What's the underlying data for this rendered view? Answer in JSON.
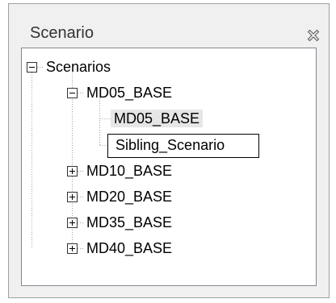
{
  "panel": {
    "title": "Scenario",
    "close_icon": "close-icon"
  },
  "tree": {
    "root": {
      "label": "Scenarios",
      "expanded": true,
      "children": [
        {
          "label": "MD05_BASE",
          "expanded": true,
          "children": [
            {
              "label": "MD05_BASE",
              "state": "hover"
            },
            {
              "label": "Sibling_Scenario",
              "state": "editing"
            }
          ]
        },
        {
          "label": "MD10_BASE",
          "expanded": false
        },
        {
          "label": "MD20_BASE",
          "expanded": false
        },
        {
          "label": "MD35_BASE",
          "expanded": false
        },
        {
          "label": "MD40_BASE",
          "expanded": false
        }
      ]
    }
  },
  "icons": {
    "collapse": "minus-box-icon",
    "expand": "plus-box-icon"
  }
}
